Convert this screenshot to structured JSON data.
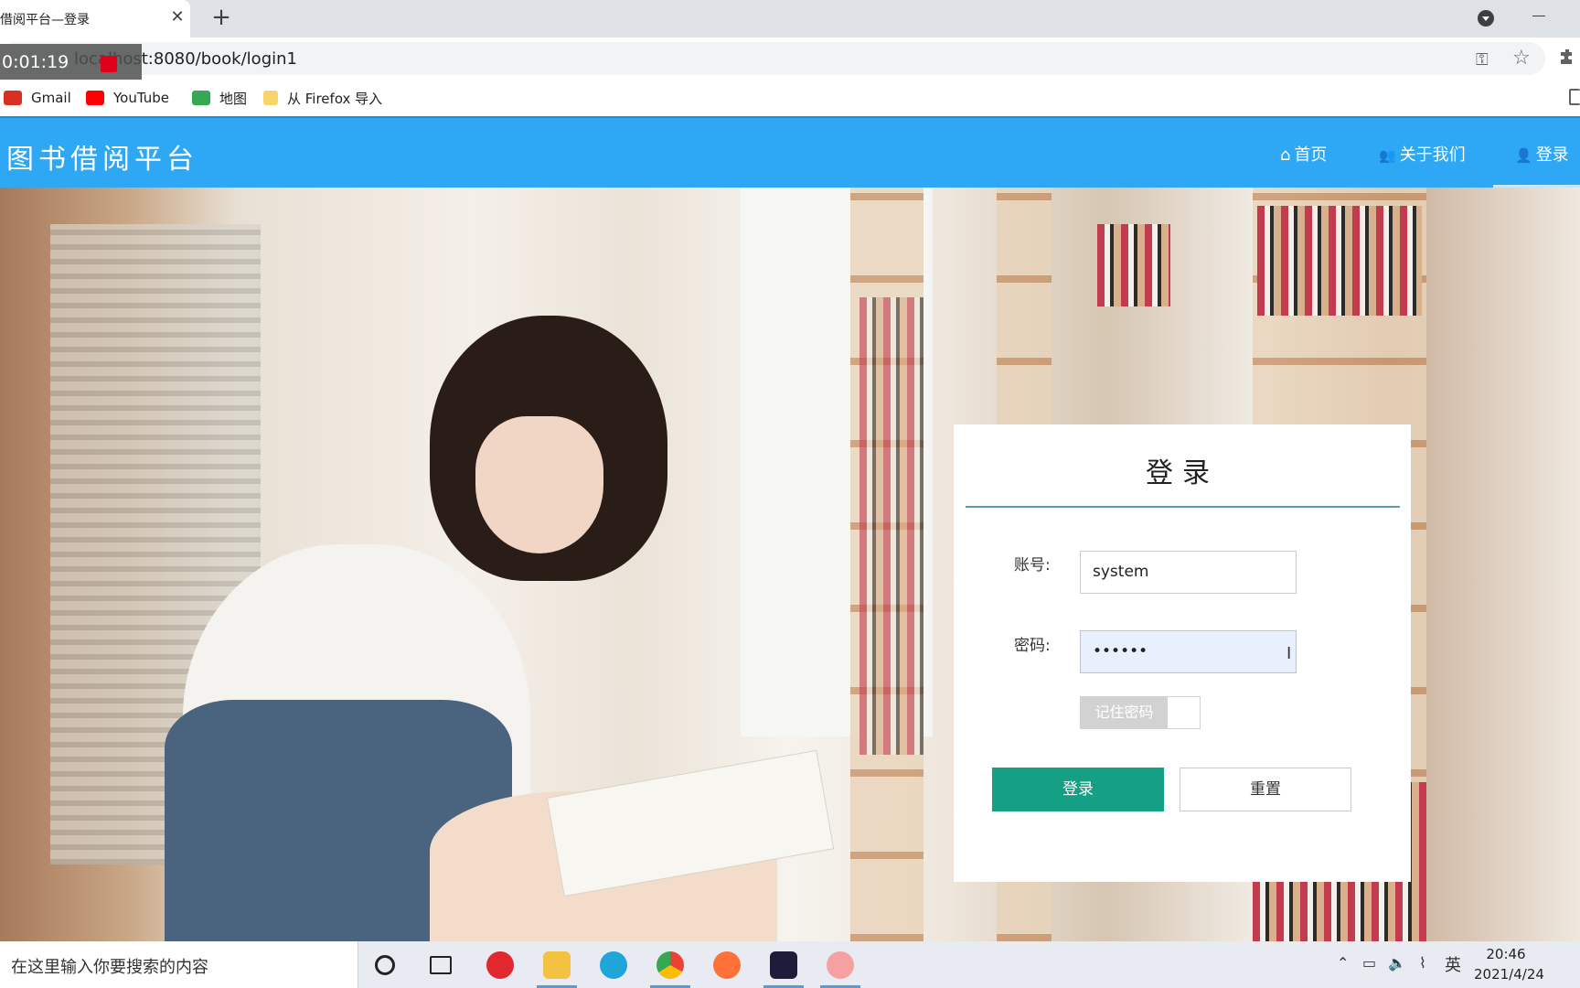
{
  "browser": {
    "tab_title": "借阅平台—登录",
    "tab_close": "✕",
    "new_tab": "+",
    "url": "localhost:8080/book/login1",
    "recorder_time": "0:01:19"
  },
  "bookmarks": [
    {
      "label": "Gmail",
      "icon": "gmail-icon",
      "color": "#d93025"
    },
    {
      "label": "YouTube",
      "icon": "youtube-icon",
      "color": "#ff0000"
    },
    {
      "label": "地图",
      "icon": "maps-icon",
      "color": "#34a853"
    },
    {
      "label": "从 Firefox 导入",
      "icon": "folder-icon",
      "color": "#f9d46b"
    }
  ],
  "site": {
    "brand": "图书借阅平台",
    "nav": [
      {
        "label": "首页",
        "icon": "home-icon",
        "glyph": "⌂"
      },
      {
        "label": "关于我们",
        "icon": "users-icon",
        "glyph": "👥"
      },
      {
        "label": "登录",
        "icon": "user-icon",
        "glyph": "👤"
      }
    ],
    "active_nav": "登录"
  },
  "login": {
    "title": "登录",
    "account_label": "账号:",
    "account_value": "system",
    "password_label": "密码:",
    "password_value": "••••••",
    "remember_label": "记住密码",
    "remember_checked": false,
    "submit_label": "登录",
    "reset_label": "重置",
    "primary_color": "#159f84",
    "navbar_color": "#2ea7f5"
  },
  "taskbar": {
    "search_placeholder": "在这里输入你要搜索的内容",
    "apps": [
      "cortana-icon",
      "task-view-icon",
      "netease-music-icon",
      "file-explorer-icon",
      "edge-icon",
      "chrome-icon",
      "firefox-icon",
      "intellij-icon",
      "app-icon"
    ],
    "ime": "英",
    "time": "20:46",
    "date": "2021/4/24"
  }
}
